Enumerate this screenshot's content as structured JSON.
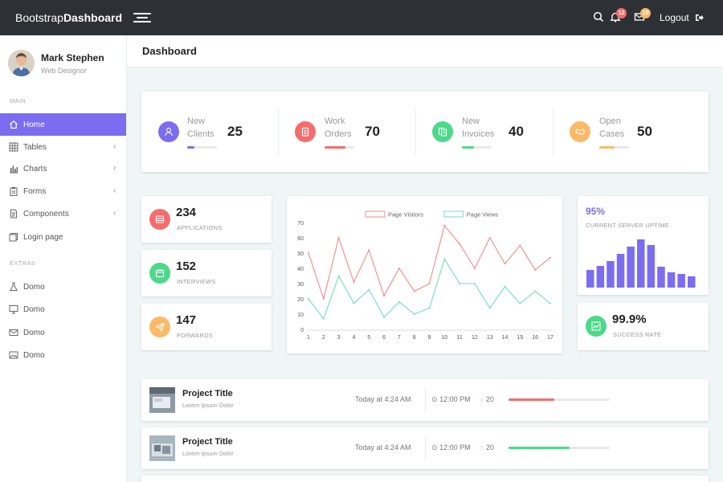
{
  "topbar": {
    "brand_light": "Bootstrap",
    "brand_bold": "Dashboard",
    "notif_count": "12",
    "mail_count": "10",
    "logout_label": "Logout",
    "icons": [
      "menu-icon",
      "search-icon",
      "bell-icon",
      "mail-icon",
      "logout-icon"
    ]
  },
  "profile": {
    "name": "Mark Stephen",
    "role": "Web Designor"
  },
  "sidebar": {
    "main_label": "MAIN",
    "extras_label": "EXTRAS",
    "items": [
      {
        "label": "Home",
        "icon": "home-icon",
        "active": true
      },
      {
        "label": "Tables",
        "icon": "grid-icon",
        "chevron": true
      },
      {
        "label": "Charts",
        "icon": "bar-chart-icon",
        "chevron": true
      },
      {
        "label": "Forms",
        "icon": "clipboard-icon",
        "chevron": true
      },
      {
        "label": "Components",
        "icon": "document-icon",
        "chevron": true
      },
      {
        "label": "Login page",
        "icon": "login-icon"
      }
    ],
    "extras": [
      {
        "label": "Domo",
        "icon": "flask-icon"
      },
      {
        "label": "Domo",
        "icon": "monitor-icon"
      },
      {
        "label": "Domo",
        "icon": "envelope-icon"
      },
      {
        "label": "Domo",
        "icon": "image-icon"
      }
    ]
  },
  "page": {
    "title": "Dashboard"
  },
  "stats": [
    {
      "line1": "New",
      "line2": "Clients",
      "value": "25",
      "progress": 0.25,
      "color": "#7c6cf0"
    },
    {
      "line1": "Work",
      "line2": "Orders",
      "value": "70",
      "progress": 0.7,
      "color": "#f56c6c"
    },
    {
      "line1": "New",
      "line2": "Invoices",
      "value": "40",
      "progress": 0.4,
      "color": "#4cd98a"
    },
    {
      "line1": "Open",
      "line2": "Cases",
      "value": "50",
      "progress": 0.5,
      "color": "#fdb968"
    }
  ],
  "mini_cards": [
    {
      "value": "234",
      "label": "APPLICATIONS",
      "color": "#f56c6c",
      "icon": "list-icon"
    },
    {
      "value": "152",
      "label": "INTERVIEWS",
      "color": "#4cd98a",
      "icon": "calendar-icon"
    },
    {
      "value": "147",
      "label": "FORWARDS",
      "color": "#fdb968",
      "icon": "paper-plane-icon"
    }
  ],
  "chart_data": {
    "type": "line",
    "x": [
      1,
      2,
      3,
      4,
      5,
      6,
      7,
      8,
      9,
      10,
      11,
      12,
      13,
      14,
      15,
      16,
      17
    ],
    "ylim": [
      0,
      70
    ],
    "yticks": [
      0,
      10,
      20,
      30,
      40,
      50,
      60,
      70
    ],
    "series": [
      {
        "name": "Page Visitors",
        "color": "#f08a8e",
        "values": [
          50,
          20,
          60,
          31,
          52,
          22,
          40,
          25,
          30,
          68,
          56,
          40,
          60,
          43,
          55,
          39,
          47
        ]
      },
      {
        "name": "Page Views",
        "color": "#6fe0b3",
        "values": [
          20,
          7,
          35,
          17,
          26,
          8,
          18,
          10,
          14,
          46,
          30,
          30,
          14,
          28,
          17,
          25,
          17
        ]
      }
    ],
    "legend": "top",
    "grid": false
  },
  "uptime": {
    "percent": "95%",
    "label": "CURRENT SERVER UPTIME",
    "bars": [
      22,
      27,
      33,
      42,
      51,
      60,
      53,
      26,
      19,
      17,
      14
    ],
    "color": "#7c6cf0"
  },
  "success": {
    "value": "99.9%",
    "label": "SUCCESS RATE",
    "color": "#4cd98a",
    "icon": "trending-up-icon"
  },
  "projects": [
    {
      "title": "Project Title",
      "subtitle": "Lorem Ipsum Dolor",
      "date": "Today at 4:24 AM",
      "time": "12:00 PM",
      "comments": "20",
      "progress": 0.45,
      "color": "#f56c6c"
    },
    {
      "title": "Project Title",
      "subtitle": "Lorem Ipsum Dolor",
      "date": "Today at 4:24 AM",
      "time": "12:00 PM",
      "comments": "20",
      "progress": 0.6,
      "color": "#4cd98a"
    }
  ]
}
